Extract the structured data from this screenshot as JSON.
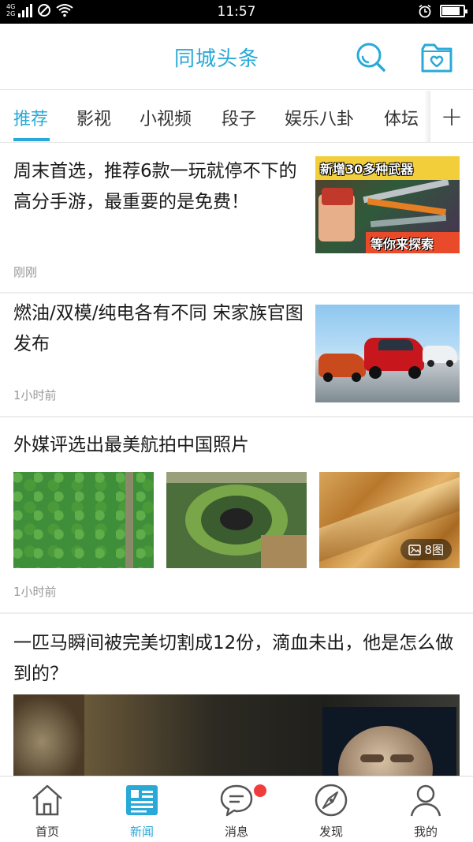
{
  "status_bar": {
    "network_top": "4G",
    "network_bottom": "2G",
    "time": "11:57",
    "battery_level": 0.85
  },
  "header": {
    "title": "同城头条",
    "accent_color": "#29a9d8"
  },
  "tabs": {
    "items": [
      "推荐",
      "影视",
      "小视频",
      "段子",
      "娱乐八卦",
      "体坛"
    ],
    "active_index": 0,
    "add_label": "+"
  },
  "feed": {
    "items": [
      {
        "title": "周末首选，推荐6款一玩就停不下的高分手游，最重要的是免费！",
        "time": "刚刚",
        "image_text_top": "新增30多种武器",
        "image_text_bottom": "等你来探索"
      },
      {
        "title": "燃油/双模/纯电各有不同 宋家族官图发布",
        "time": "1小时前"
      },
      {
        "title": "外媒评选出最美航拍中国照片",
        "time": "1小时前",
        "image_count_badge": "8图"
      },
      {
        "title": "一匹马瞬间被完美切割成12份，滴血未出，他是怎么做到的？"
      }
    ]
  },
  "bottom_nav": {
    "items": [
      {
        "label": "首页",
        "icon": "home-icon"
      },
      {
        "label": "新闻",
        "icon": "news-icon"
      },
      {
        "label": "消息",
        "icon": "message-icon"
      },
      {
        "label": "发现",
        "icon": "compass-icon"
      },
      {
        "label": "我的",
        "icon": "user-icon"
      }
    ],
    "active_index": 1
  }
}
